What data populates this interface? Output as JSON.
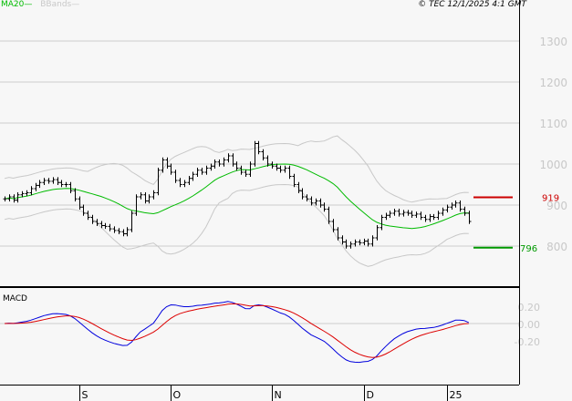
{
  "chart_data": {
    "type": "ohlc",
    "legend": [
      {
        "label": "MA20",
        "color": "#00bb00"
      },
      {
        "label": "BBands",
        "color": "#c8c8c8"
      }
    ],
    "copyright": "© TEC 12/1/2025 4:1 GMT",
    "price_axis": {
      "ticks": [
        800,
        900,
        1000,
        1100,
        1200,
        1300
      ],
      "tick_labels": [
        "800",
        "900",
        "1000",
        "1100",
        "1200",
        "1300"
      ],
      "ylim": [
        730,
        1400
      ]
    },
    "x_labels": [
      {
        "label": "S",
        "index": 17
      },
      {
        "label": "O",
        "index": 38
      },
      {
        "label": "N",
        "index": 61
      },
      {
        "label": "D",
        "index": 82
      },
      {
        "label": "25",
        "index": 101
      }
    ],
    "closes": [
      915,
      920,
      912,
      925,
      928,
      930,
      940,
      948,
      955,
      960,
      958,
      962,
      955,
      950,
      950,
      935,
      915,
      895,
      880,
      870,
      860,
      855,
      850,
      848,
      842,
      838,
      835,
      830,
      840,
      880,
      920,
      925,
      910,
      920,
      930,
      985,
      1010,
      995,
      980,
      960,
      950,
      955,
      965,
      975,
      985,
      980,
      990,
      995,
      1005,
      1000,
      1010,
      1020,
      1000,
      990,
      980,
      975,
      1000,
      1050,
      1030,
      1015,
      1000,
      995,
      990,
      985,
      990,
      970,
      950,
      935,
      920,
      915,
      905,
      910,
      900,
      890,
      860,
      840,
      820,
      810,
      800,
      805,
      810,
      808,
      812,
      805,
      820,
      845,
      870,
      875,
      880,
      885,
      878,
      882,
      880,
      875,
      878,
      870,
      865,
      872,
      870,
      880,
      888,
      895,
      900,
      905,
      890,
      880,
      860
    ],
    "resistance": {
      "value": 919,
      "label": "919",
      "color": "#cc0000"
    },
    "support": {
      "value": 796,
      "label": "796",
      "color": "#009900"
    },
    "macd": {
      "title": "MACD",
      "ticks": [
        0.2,
        0,
        -0.2
      ],
      "tick_labels": [
        "0.20",
        "0.00",
        "-0.20"
      ],
      "ylim": [
        -0.55,
        0.35
      ],
      "macd_color": "#0000dd",
      "signal_color": "#dd0000"
    }
  }
}
